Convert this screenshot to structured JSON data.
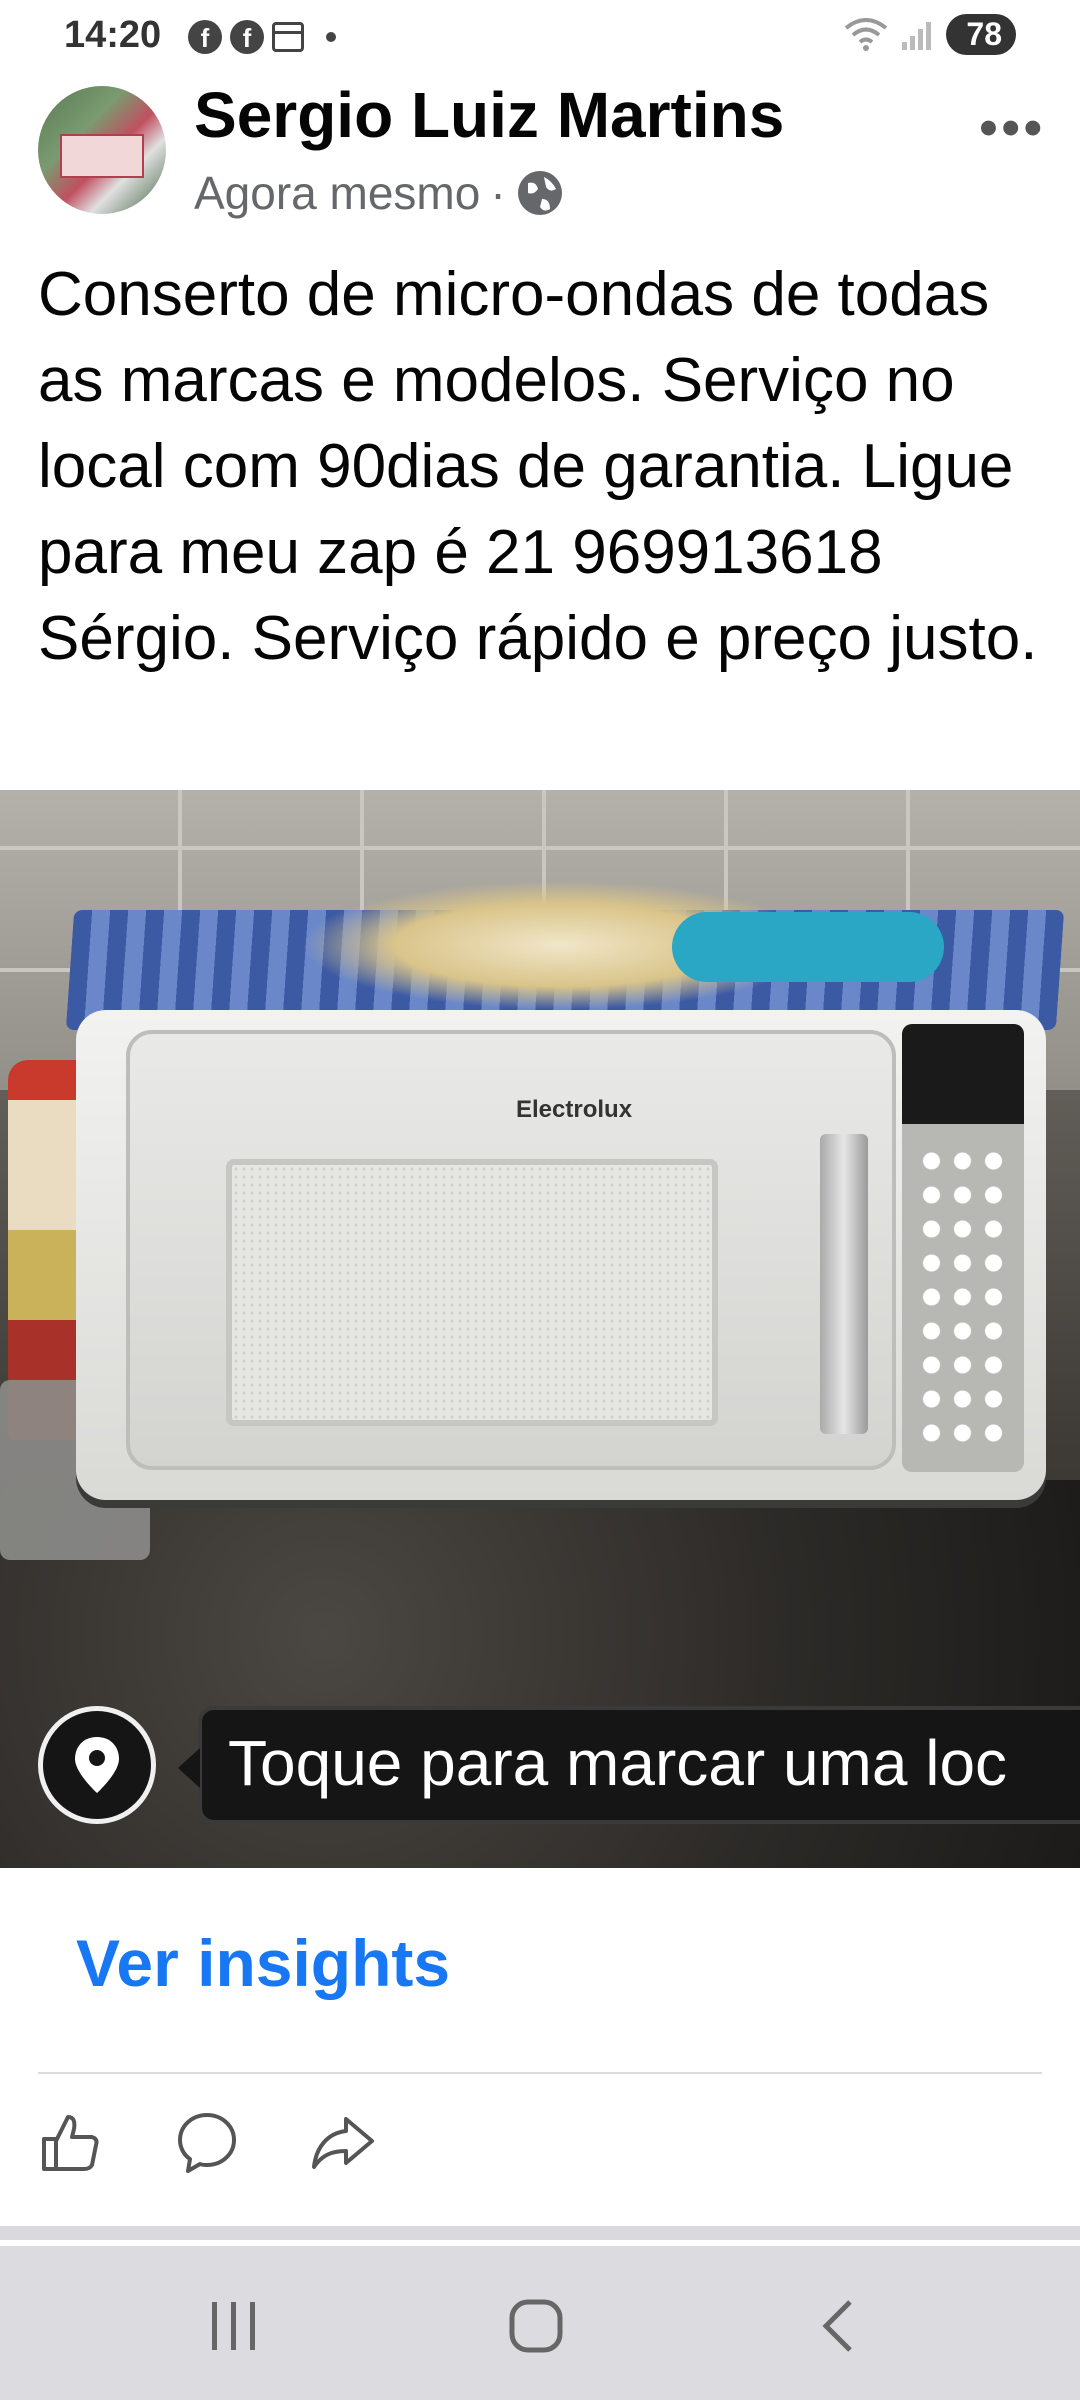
{
  "status_bar": {
    "time": "14:20",
    "battery": "78"
  },
  "post": {
    "author": "Sergio Luiz Martins",
    "time": "Agora mesmo",
    "separator": "·",
    "text": "Conserto de micro-ondas de todas as marcas e modelos. Serviço no local com 90dias de garantia. Ligue para meu zap é 21 969913618 Sérgio. Serviço rápido e preço justo.",
    "photo": {
      "brand": "Electrolux"
    },
    "location_prompt": "Toque para marcar uma loc",
    "insights_label": "Ver insights"
  },
  "icons": {
    "more": "more-options-icon",
    "privacy": "globe-icon",
    "location": "location-pin-icon",
    "like": "like-icon",
    "comment": "comment-icon",
    "share": "share-icon",
    "nav_recent": "recent-apps-icon",
    "nav_home": "home-icon",
    "nav_back": "back-icon"
  },
  "colors": {
    "accent": "#1877f2",
    "text": "#050505",
    "secondary": "#65676b"
  }
}
